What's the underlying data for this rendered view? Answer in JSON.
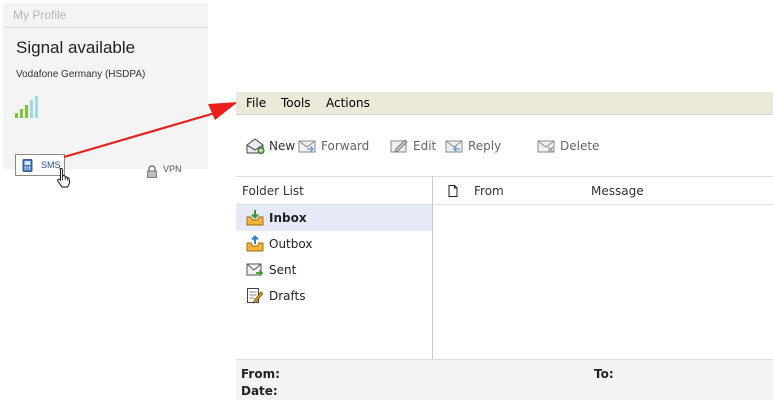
{
  "profile": {
    "header": "My Profile",
    "signal_status": "Signal available",
    "network": "Vodafone Germany (HSDPA)",
    "signal_level_bars": 5,
    "sms_label": "SMS",
    "vpn_label": "VPN"
  },
  "menu": {
    "file": "File",
    "tools": "Tools",
    "actions": "Actions"
  },
  "toolbar": {
    "new": "New",
    "forward": "Forward",
    "edit": "Edit",
    "reply": "Reply",
    "delete": "Delete"
  },
  "columns": {
    "folder_list": "Folder List",
    "from": "From",
    "message": "Message"
  },
  "folders": [
    {
      "label": "Inbox",
      "icon": "inbox-icon",
      "selected": true
    },
    {
      "label": "Outbox",
      "icon": "outbox-icon",
      "selected": false
    },
    {
      "label": "Sent",
      "icon": "sent-icon",
      "selected": false
    },
    {
      "label": "Drafts",
      "icon": "drafts-icon",
      "selected": false
    }
  ],
  "details": {
    "from_label": "From:",
    "to_label": "To:",
    "date_label": "Date:"
  },
  "colors": {
    "arrow": "#e8201c",
    "menubar": "#ece9d8",
    "selected_folder": "#e6e9f7",
    "signal_green": "#7fc63a"
  }
}
